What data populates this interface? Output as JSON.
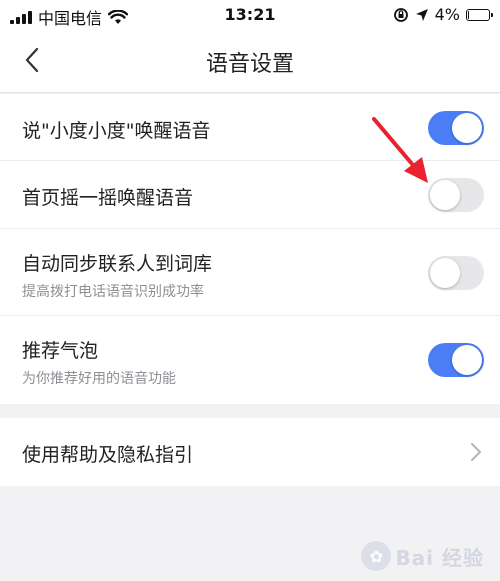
{
  "status_bar": {
    "carrier": "中国电信",
    "time": "13:21",
    "battery": "4%",
    "battery_level": 0.04,
    "icons": [
      "signal-icon",
      "wifi-icon",
      "orientation-lock-icon",
      "location-arrow-icon",
      "battery-icon"
    ]
  },
  "navbar": {
    "title": "语音设置",
    "back_icon": "chevron-left-icon"
  },
  "settings": {
    "items": [
      {
        "label": "说\"小度小度\"唤醒语音",
        "sub": "",
        "enabled": true
      },
      {
        "label": "首页摇一摇唤醒语音",
        "sub": "",
        "enabled": false
      },
      {
        "label": "自动同步联系人到词库",
        "sub": "提高拨打电话语音识别成功率",
        "enabled": false
      },
      {
        "label": "推荐气泡",
        "sub": "为你推荐好用的语音功能",
        "enabled": true
      }
    ]
  },
  "help": {
    "label": "使用帮助及隐私指引",
    "icon": "chevron-right-icon"
  },
  "annotation": {
    "arrow_color": "#e8222e",
    "icon": "red-arrow-icon"
  },
  "watermark": {
    "text": "Bai 经验",
    "icon": "baidu-paw-icon"
  },
  "colors": {
    "accent": "#4b7ef6",
    "switch_off": "#e7e7ea",
    "background": "#f2f2f4"
  }
}
